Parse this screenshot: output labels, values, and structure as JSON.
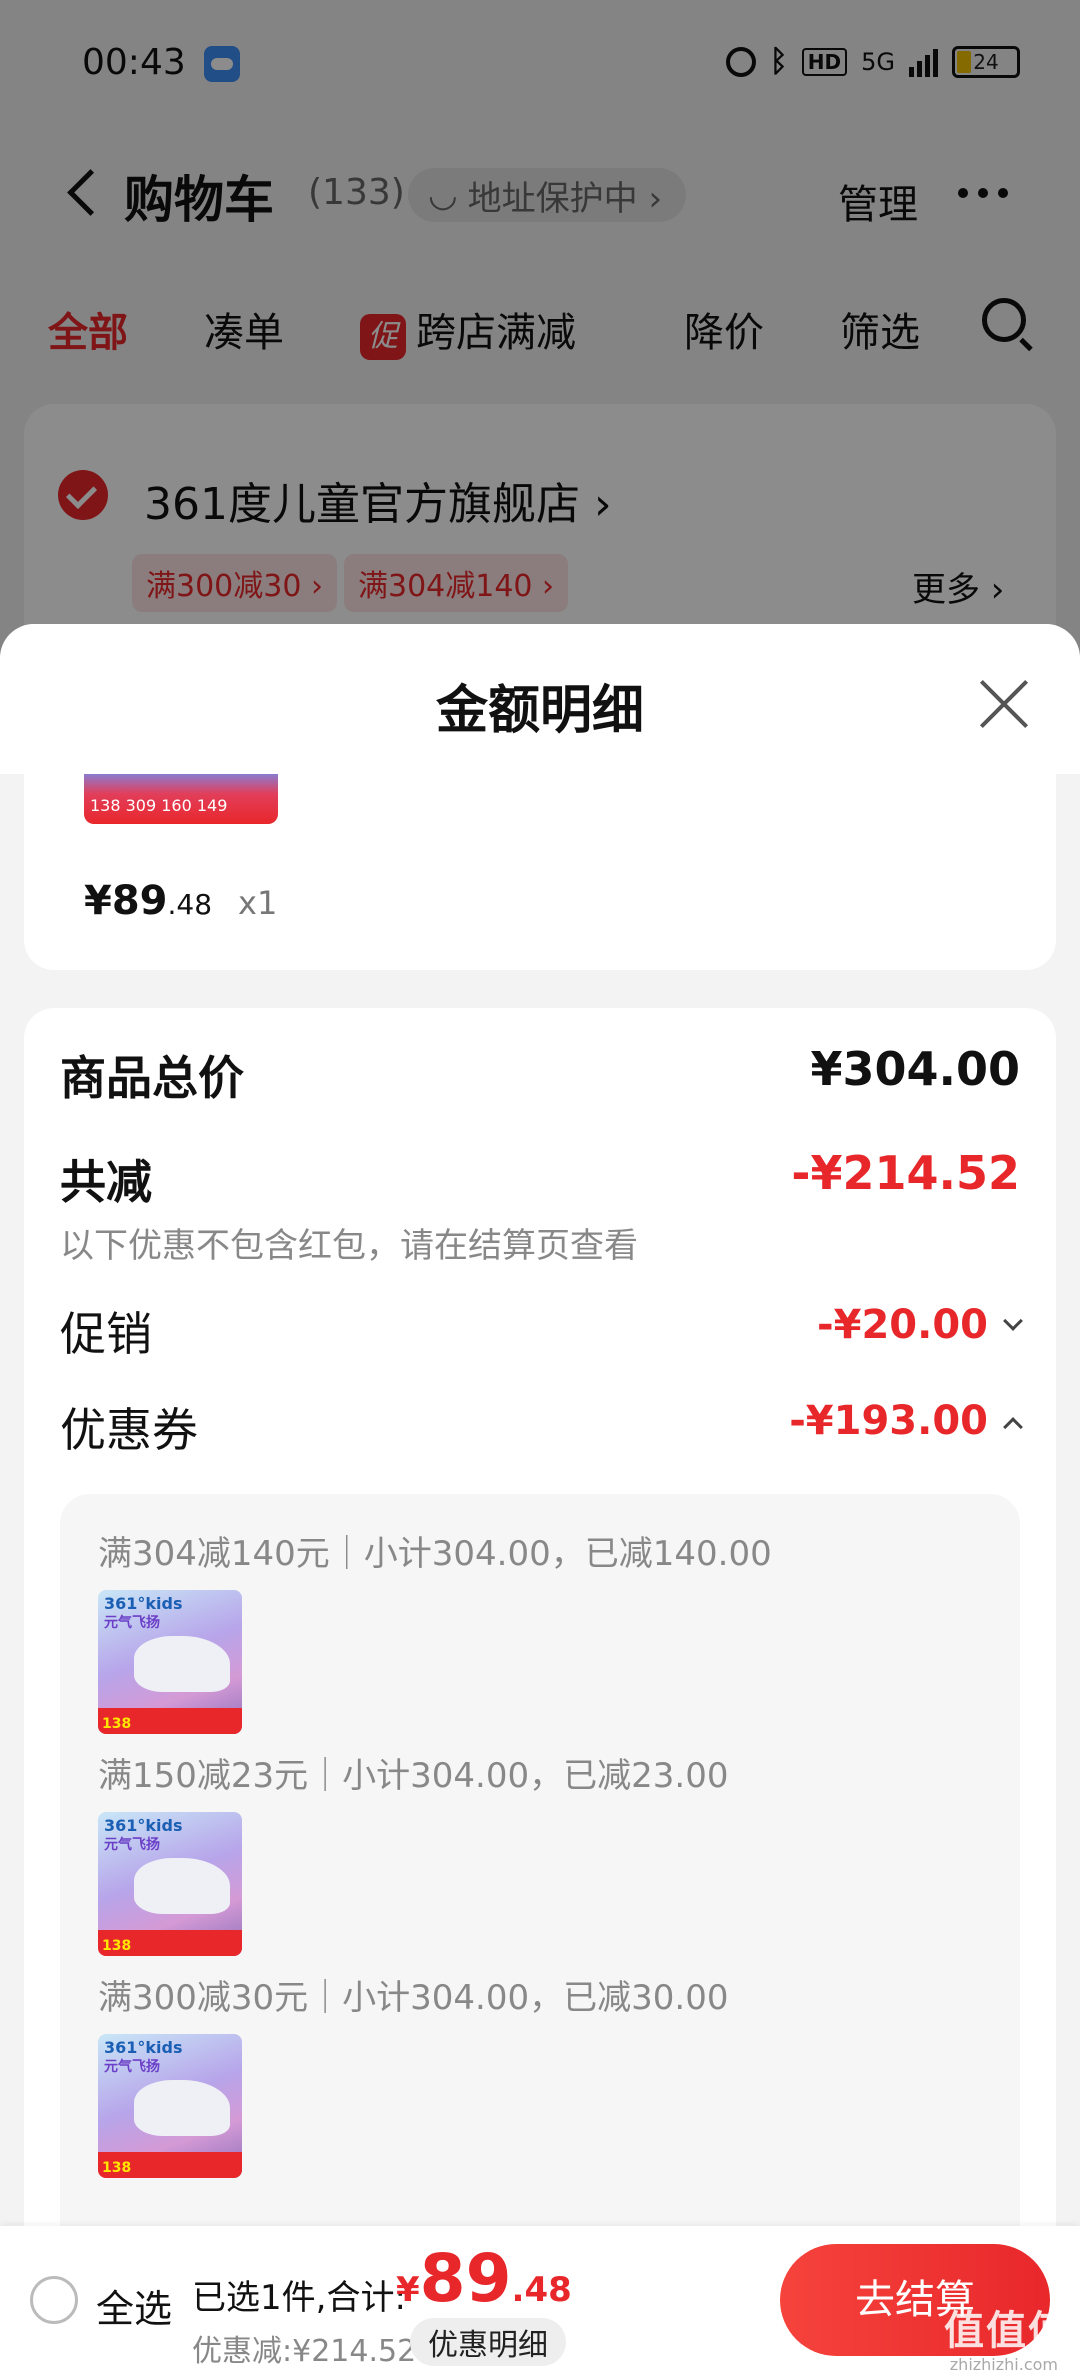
{
  "status_bar": {
    "time": "00:43",
    "network": "5G",
    "battery": "24"
  },
  "nav": {
    "title": "购物车",
    "count": "(133)",
    "address_chip": "地址保护中 ›",
    "manage": "管理"
  },
  "tabs": [
    {
      "label": "全部"
    },
    {
      "label": "凑单"
    },
    {
      "badge": "促",
      "label": "跨店满减"
    },
    {
      "label": "降价"
    },
    {
      "label": "筛选"
    }
  ],
  "store": {
    "name": "361度儿童官方旗舰店 ›",
    "coupons": [
      "满300减30 ›",
      "满304减140 ›"
    ],
    "more": "更多 ›"
  },
  "sheet": {
    "title": "金额明细",
    "item": {
      "price_int": "¥89",
      "price_dec": ".48",
      "qty": "x1",
      "thumb_text": "138   309   160   149"
    },
    "total_label": "商品总价",
    "total_value": "¥304.00",
    "reduce_label": "共减",
    "reduce_value": "-¥214.52",
    "reduce_note": "以下优惠不包含红包，请在结算页查看",
    "promo_label": "促销",
    "promo_value": "-¥20.00",
    "coupon_label": "优惠券",
    "coupon_value": "-¥193.00",
    "coupon_lines": [
      "满304减140元｜小计304.00，已减140.00",
      "满150减23元｜小计304.00，已减23.00",
      "满300减30元｜小计304.00，已减30.00"
    ],
    "thumb": {
      "brand": "361°kids",
      "tagline": "元气飞扬",
      "price": "138"
    }
  },
  "bottom_bar": {
    "select_all": "全选",
    "summary": "已选1件,合计:",
    "price_cur": "¥",
    "price_int": "89",
    "price_dec": ".48",
    "discount": "优惠减:¥214.52",
    "detail_chip": "优惠明细",
    "checkout": "去结算",
    "watermark": "值值值",
    "watermark_url": "zhizhizhi.com"
  },
  "colors": {
    "accent": "#e8272b"
  }
}
